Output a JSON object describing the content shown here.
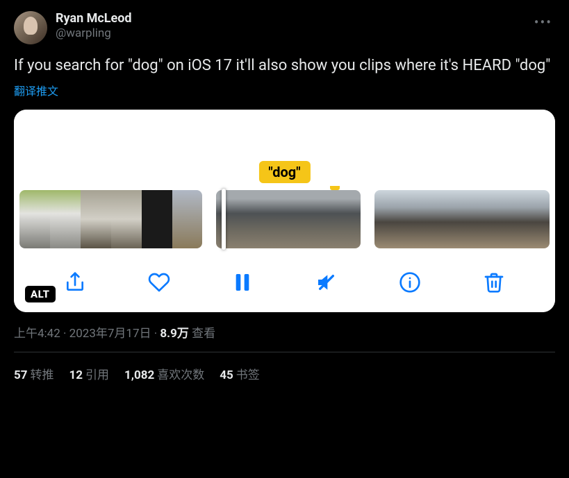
{
  "user": {
    "display_name": "Ryan McLeod",
    "handle": "@warpling"
  },
  "tweet_text": "If you search for \"dog\" on iOS 17 it'll also show you clips where it's HEARD \"dog\"",
  "translate_label": "翻译推文",
  "media": {
    "caption_bubble": "\"dog\"",
    "alt_badge": "ALT"
  },
  "meta": {
    "time": "上午4:42",
    "date": "2023年7月17日",
    "views_number": "8.9万",
    "views_label": "查看"
  },
  "stats": {
    "retweets_num": "57",
    "retweets_label": "转推",
    "quotes_num": "12",
    "quotes_label": "引用",
    "likes_num": "1,082",
    "likes_label": "喜欢次数",
    "bookmarks_num": "45",
    "bookmarks_label": "书签"
  }
}
